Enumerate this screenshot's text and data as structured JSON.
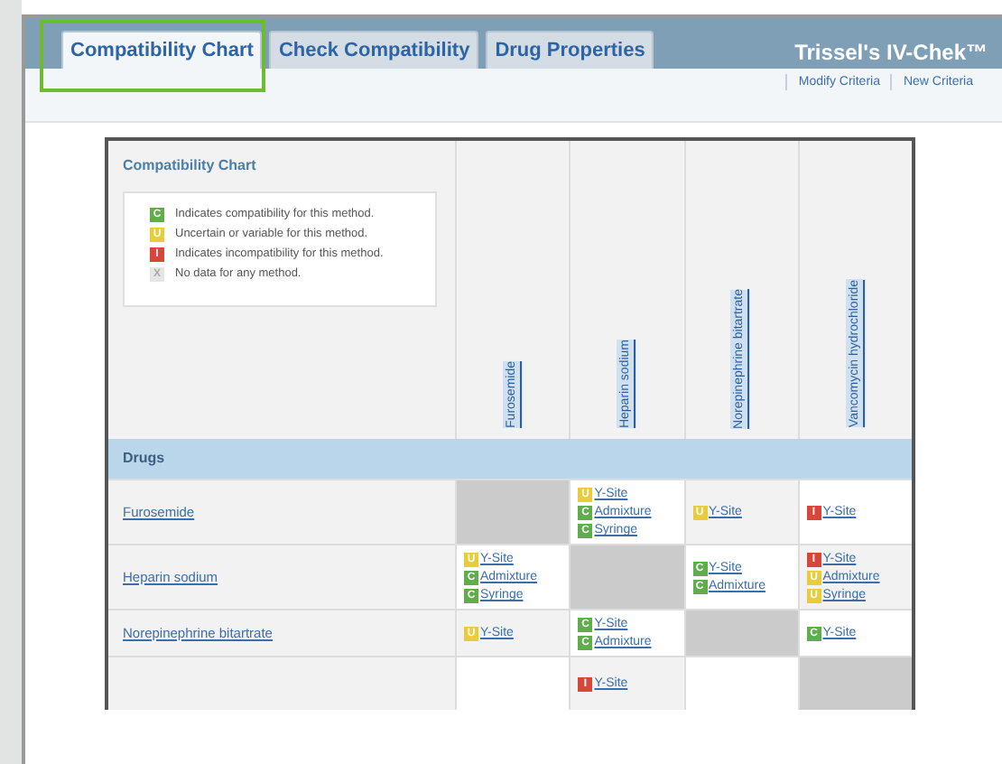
{
  "tabs": [
    {
      "label": "Compatibility Chart",
      "selected": true,
      "highlighted": true
    },
    {
      "label": "Check Compatibility",
      "selected": false,
      "highlighted": false
    },
    {
      "label": "Drug Properties",
      "selected": false,
      "highlighted": false
    }
  ],
  "app_title": "Trissel's IV-Chek™",
  "links": [
    "Modify Criteria",
    "New Criteria"
  ],
  "chart": {
    "title": "Compatibility Chart",
    "legend": [
      {
        "color": "#5fae4b",
        "mark": "C",
        "text": "Indicates compatibility for this method."
      },
      {
        "color": "#e8cc3a",
        "mark": "U",
        "text": "Uncertain or variable for this method."
      },
      {
        "color": "#d8453b",
        "mark": "I",
        "text": "Indicates incompatibility for this method."
      },
      {
        "color": "#e6e6e6",
        "mark": "X",
        "text": "No data for any method."
      }
    ],
    "columns": [
      "Furosemide",
      "Heparin sodium",
      "Norepinephrine bitartrate",
      "Vancomycin hydrochloride"
    ],
    "section": "Drugs",
    "rows": [
      {
        "drug": "Furosemide",
        "cells": [
          {
            "same": true
          },
          {
            "same": false,
            "entries": [
              {
                "color": "#e8cc3a",
                "mark": "U",
                "method": "Y-Site"
              },
              {
                "color": "#5fae4b",
                "mark": "C",
                "method": "Admixture"
              },
              {
                "color": "#5fae4b",
                "mark": "C",
                "method": "Syringe"
              }
            ]
          },
          {
            "same": false,
            "entries": [
              {
                "color": "#e8cc3a",
                "mark": "U",
                "method": "Y-Site"
              }
            ]
          },
          {
            "same": false,
            "entries": [
              {
                "color": "#d8453b",
                "mark": "I",
                "method": "Y-Site"
              }
            ]
          }
        ]
      },
      {
        "drug": "Heparin sodium",
        "cells": [
          {
            "same": false,
            "entries": [
              {
                "color": "#e8cc3a",
                "mark": "U",
                "method": "Y-Site"
              },
              {
                "color": "#5fae4b",
                "mark": "C",
                "method": "Admixture"
              },
              {
                "color": "#5fae4b",
                "mark": "C",
                "method": "Syringe"
              }
            ]
          },
          {
            "same": true
          },
          {
            "same": false,
            "entries": [
              {
                "color": "#5fae4b",
                "mark": "C",
                "method": "Y-Site"
              },
              {
                "color": "#5fae4b",
                "mark": "C",
                "method": "Admixture"
              }
            ]
          },
          {
            "same": false,
            "entries": [
              {
                "color": "#d8453b",
                "mark": "I",
                "method": "Y-Site"
              },
              {
                "color": "#e8cc3a",
                "mark": "U",
                "method": "Admixture"
              },
              {
                "color": "#e8cc3a",
                "mark": "U",
                "method": "Syringe"
              }
            ]
          }
        ]
      },
      {
        "drug": "Norepinephrine bitartrate",
        "cells": [
          {
            "same": false,
            "entries": [
              {
                "color": "#e8cc3a",
                "mark": "U",
                "method": "Y-Site"
              }
            ]
          },
          {
            "same": false,
            "entries": [
              {
                "color": "#5fae4b",
                "mark": "C",
                "method": "Y-Site"
              },
              {
                "color": "#5fae4b",
                "mark": "C",
                "method": "Admixture"
              }
            ]
          },
          {
            "same": true
          },
          {
            "same": false,
            "entries": [
              {
                "color": "#5fae4b",
                "mark": "C",
                "method": "Y-Site"
              }
            ]
          }
        ]
      },
      {
        "cells": [
          {
            "same": false
          },
          {
            "same": false,
            "entries": [
              {
                "color": "#d8453b",
                "mark": "I",
                "method": "Y-Site"
              }
            ]
          },
          {
            "same": false
          },
          {
            "same": true
          }
        ]
      }
    ]
  }
}
